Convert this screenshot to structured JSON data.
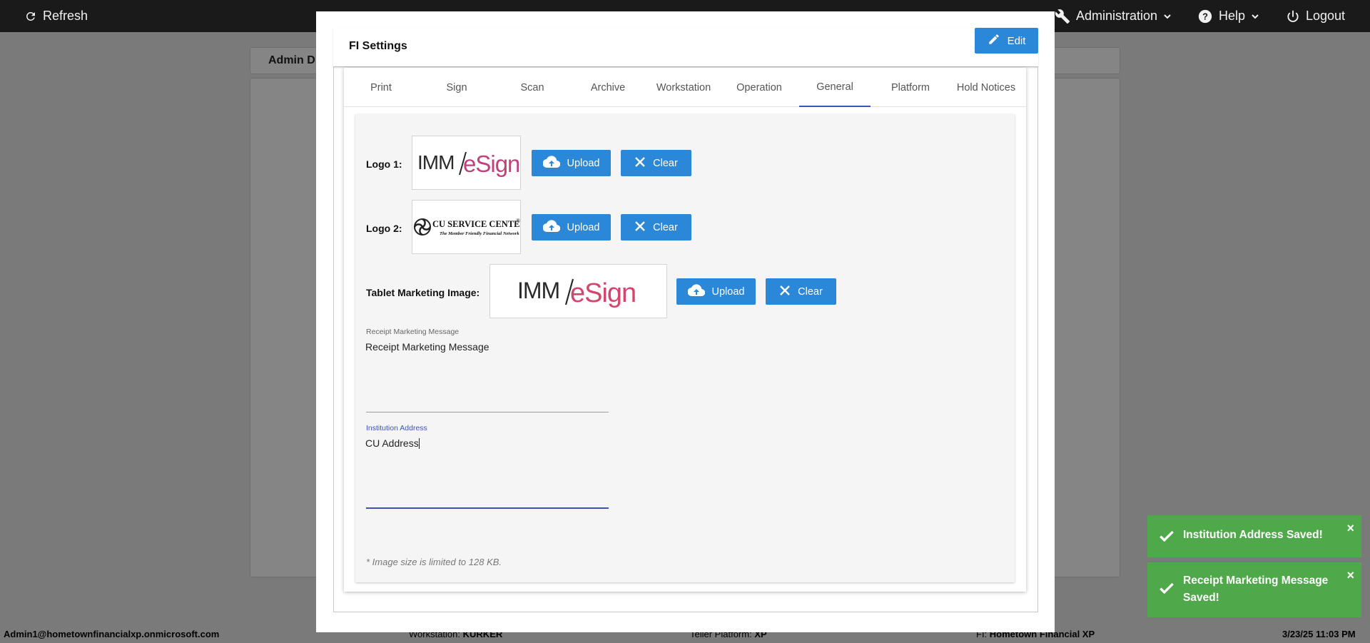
{
  "topbar": {
    "refresh_label": "Refresh",
    "administration_label": "Administration",
    "help_label": "Help",
    "logout_label": "Logout"
  },
  "background": {
    "header_title": "Admin D"
  },
  "modal": {
    "title": "FI Settings",
    "edit_label": "Edit",
    "tabs": [
      "Print",
      "Sign",
      "Scan",
      "Archive",
      "Workstation",
      "Operation",
      "General",
      "Platform",
      "Hold Notices"
    ],
    "active_tab": "General",
    "general": {
      "logo1_label": "Logo 1:",
      "logo2_label": "Logo 2:",
      "tablet_label": "Tablet Marketing Image:",
      "upload_label": "Upload",
      "clear_label": "Clear",
      "logo_imm_prefix": "IMM",
      "logo_esign": "eSign",
      "logo_cu_main": "CU SERVICE CENTERS",
      "logo_cu_reg": "®",
      "logo_cu_tagline": "The Member Friendly Financial Network",
      "receipt_field_label": "Receipt Marketing Message",
      "receipt_field_value": "Receipt Marketing Message",
      "address_field_label": "Institution Address",
      "address_field_value": "CU Address",
      "note": "* Image size is limited to 128 KB."
    }
  },
  "footer": {
    "user": "Admin1@hometownfinancialxp.onmicrosoft.com",
    "workstation_label": "Workstation:",
    "workstation_value": "KURKER",
    "platform_label": "Teller Platform:",
    "platform_value": "XP",
    "fi_label": "FI:",
    "fi_value": "Hometown Financial XP",
    "datetime": "3/23/25 11:03 PM"
  },
  "toasts": [
    {
      "line1": "Institution Address Saved!",
      "line2": ""
    },
    {
      "line1": "Receipt Marketing Message",
      "line2": "Saved!"
    }
  ],
  "colors": {
    "primary_button": "#2b88d8",
    "active_tab": "#3f51b5",
    "toast_success": "#4fa94a",
    "topbar": "#1a1a1a"
  }
}
